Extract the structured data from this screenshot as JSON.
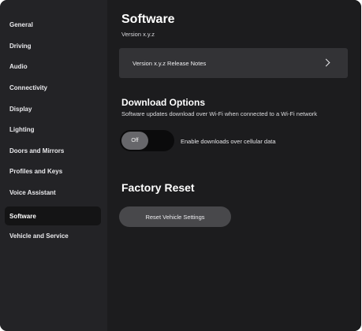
{
  "sidebar": {
    "items": [
      {
        "label": "General"
      },
      {
        "label": "Driving"
      },
      {
        "label": "Audio"
      },
      {
        "label": "Connectivity"
      },
      {
        "label": "Display"
      },
      {
        "label": "Lighting"
      },
      {
        "label": "Doors and Mirrors"
      },
      {
        "label": "Profiles and Keys"
      },
      {
        "label": "Voice Assistant"
      },
      {
        "label": "Software"
      },
      {
        "label": "Vehicle and Service"
      }
    ],
    "active": "Software"
  },
  "main": {
    "title": "Software",
    "version": "Version x.y.z",
    "release_notes_label": "Version x.y.z Release Notes",
    "download": {
      "title": "Download Options",
      "description": "Software updates download over Wi-Fi when connected to a Wi-Fi network",
      "toggle_state": "Off",
      "toggle_label": "Enable downloads over cellular data"
    },
    "factory_reset": {
      "title": "Factory Reset",
      "button_label": "Reset Vehicle Settings"
    }
  },
  "icons": {
    "release_notes": "chevron-right-icon"
  },
  "colors": {
    "background": "#1c1c1e",
    "sidebar": "#232326",
    "active_item": "#141415",
    "row": "#333336",
    "button": "#48484b",
    "toggle_track": "#0b0b0c",
    "toggle_knob": "#67676b"
  }
}
